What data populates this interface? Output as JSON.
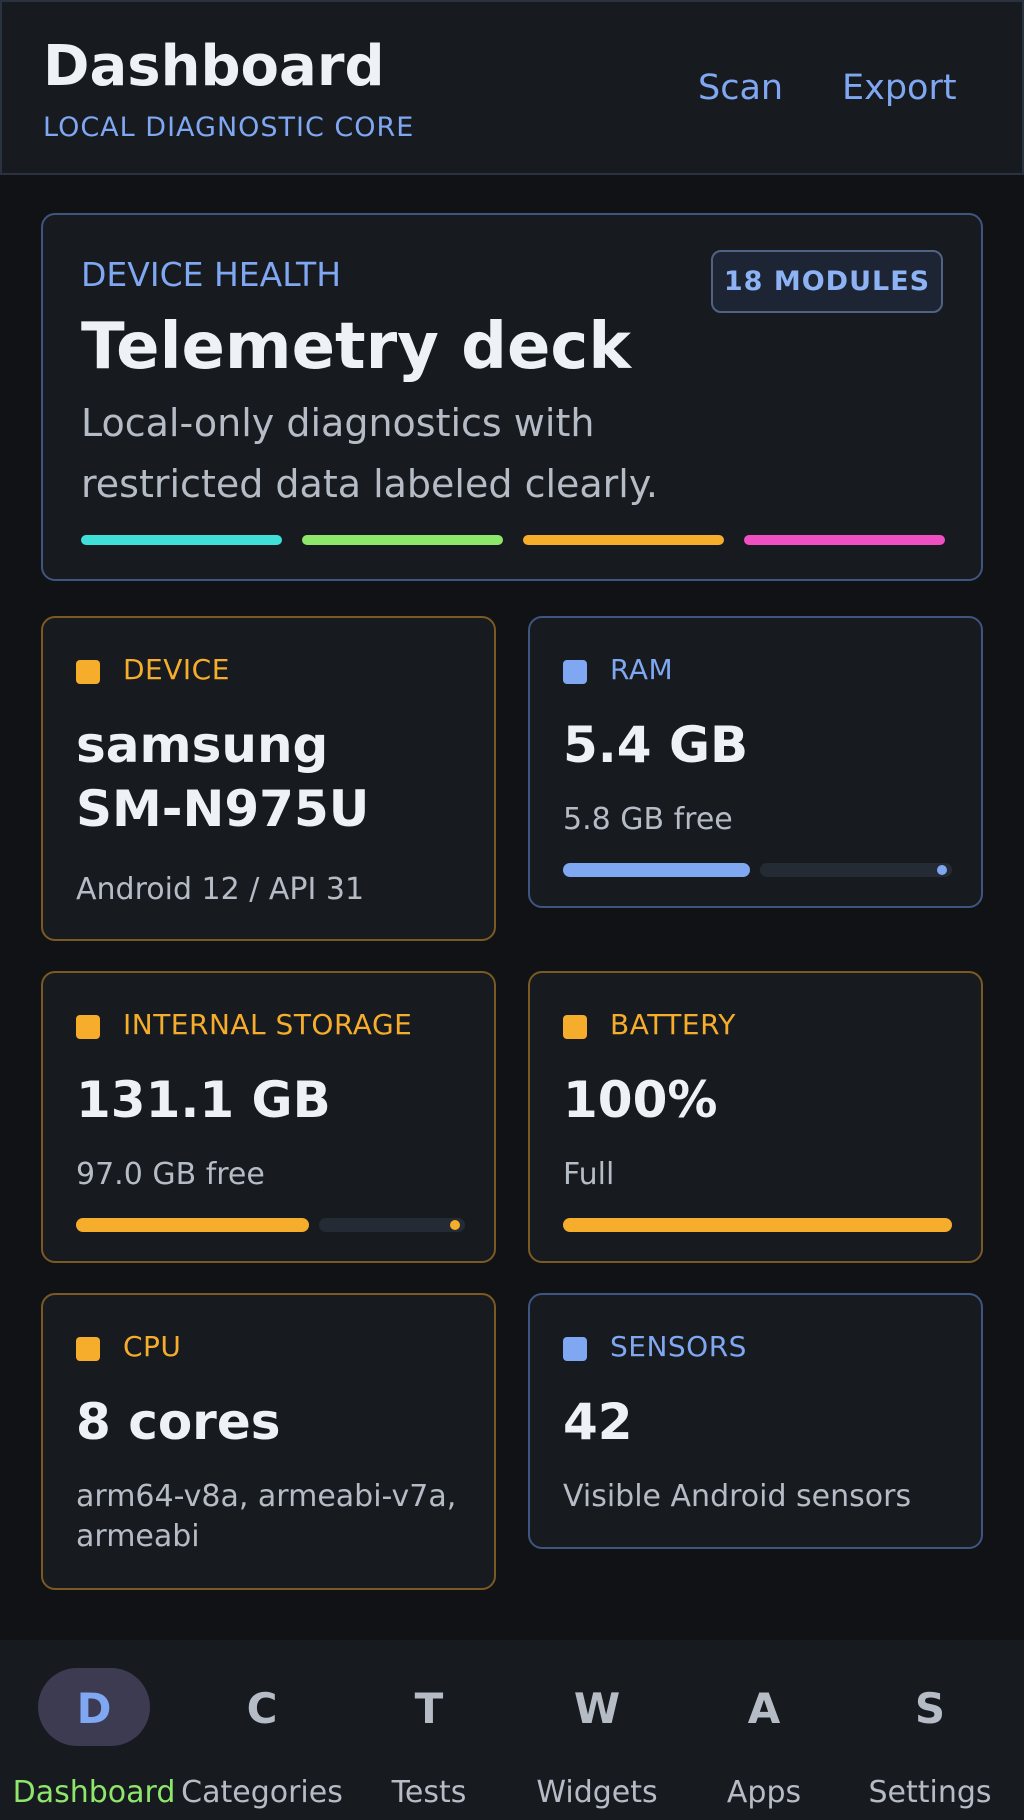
{
  "header": {
    "title": "Dashboard",
    "subtitle": "LOCAL DIAGNOSTIC CORE",
    "scan_label": "Scan",
    "export_label": "Export"
  },
  "hero": {
    "kicker": "DEVICE HEALTH",
    "badge": "18 MODULES",
    "title": "Telemetry deck",
    "description": "Local-only diagnostics with restricted data labeled clearly.",
    "stripe_colors": [
      "#3ee0d8",
      "#8ee66a",
      "#f6ad2b",
      "#f04fc2"
    ]
  },
  "colors": {
    "amber": "#f6ad2b",
    "blue": "#7fa7f2",
    "accent_green": "#8ee66a"
  },
  "cards": {
    "device": {
      "label": "DEVICE",
      "value_line1": "samsung",
      "value_line2": "SM-N975U",
      "detail": "Android 12 / API 31"
    },
    "ram": {
      "label": "RAM",
      "value": "5.4 GB",
      "detail": "5.8 GB free",
      "used_fraction": 0.48
    },
    "storage": {
      "label": "INTERNAL STORAGE",
      "value": "131.1 GB",
      "detail": "97.0 GB free",
      "used_fraction": 0.6
    },
    "battery": {
      "label": "BATTERY",
      "value": "100%",
      "detail": "Full",
      "level_fraction": 1.0
    },
    "cpu": {
      "label": "CPU",
      "value": "8 cores",
      "detail": "arm64-v8a, armeabi-v7a, armeabi"
    },
    "sensors": {
      "label": "SENSORS",
      "value": "42",
      "detail": "Visible Android sensors"
    }
  },
  "nav": {
    "items": [
      {
        "letter": "D",
        "label": "Dashboard",
        "active": true
      },
      {
        "letter": "C",
        "label": "Categories",
        "active": false
      },
      {
        "letter": "T",
        "label": "Tests",
        "active": false
      },
      {
        "letter": "W",
        "label": "Widgets",
        "active": false
      },
      {
        "letter": "A",
        "label": "Apps",
        "active": false
      },
      {
        "letter": "S",
        "label": "Settings",
        "active": false
      }
    ]
  }
}
